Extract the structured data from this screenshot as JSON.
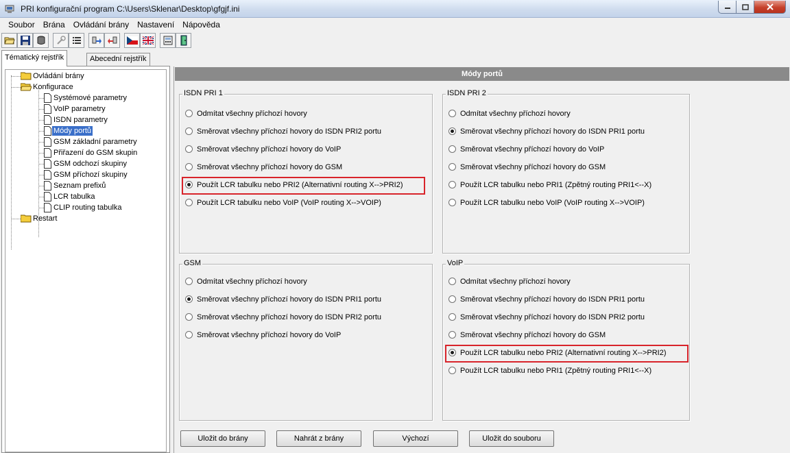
{
  "window": {
    "title": "PRI konfigurační program C:\\Users\\Sklenar\\Desktop\\gfgjf.ini"
  },
  "menu": [
    "Soubor",
    "Brána",
    "Ovládání brány",
    "Nastavení",
    "Nápověda"
  ],
  "tabs": {
    "topical": "Tématický rejstřík",
    "alphabetical": "Abecední rejstřík"
  },
  "tree": {
    "ovladani": "Ovládání brány",
    "konfigurace": "Konfigurace",
    "items": [
      "Systémové parametry",
      "VoIP parametry",
      "ISDN parametry",
      "Módy portů",
      "GSM základní parametry",
      "Přiřazení do GSM skupin",
      "GSM odchozí skupiny",
      "GSM příchozí skupiny",
      "Seznam prefixů",
      "LCR tabulka",
      "CLIP routing tabulka"
    ],
    "restart": "Restart",
    "selected": "Módy portů"
  },
  "panel": {
    "title": "Módy portů",
    "groups": {
      "pri1": {
        "title": "ISDN PRI 1",
        "options": [
          "Odmítat všechny příchozí hovory",
          "Směrovat všechny příchozí hovory do ISDN PRI2 portu",
          "Směrovat všechny příchozí hovory do VoIP",
          "Směrovat všechny příchozí hovory do GSM",
          "Použít LCR tabulku nebo PRI2 (Alternativní routing X-->PRI2)",
          "Použít LCR tabulku nebo VoIP (VoIP routing X-->VOIP)"
        ],
        "selected": 4
      },
      "pri2": {
        "title": "ISDN PRI 2",
        "options": [
          "Odmítat všechny příchozí hovory",
          "Směrovat všechny příchozí hovory do ISDN PRI1 portu",
          "Směrovat všechny příchozí hovory do VoIP",
          "Směrovat všechny příchozí hovory do GSM",
          "Použít LCR tabulku nebo PRI1 (Zpětný routing PRI1<--X)",
          "Použít LCR tabulku nebo VoIP (VoIP routing X-->VOIP)"
        ],
        "selected": 1
      },
      "gsm": {
        "title": "GSM",
        "options": [
          "Odmítat všechny příchozí hovory",
          "Směrovat všechny příchozí hovory do ISDN PRI1 portu",
          "Směrovat všechny příchozí hovory do ISDN PRI2 portu",
          "Směrovat všechny příchozí hovory do VoIP"
        ],
        "selected": 1
      },
      "voip": {
        "title": "VoIP",
        "options": [
          "Odmítat všechny příchozí hovory",
          "Směrovat všechny příchozí hovory do ISDN PRI1 portu",
          "Směrovat všechny příchozí hovory do ISDN PRI2 portu",
          "Směrovat všechny příchozí hovory do GSM",
          "Použít LCR tabulku nebo PRI2 (Alternativní routing X-->PRI2)",
          "Použít LCR tabulku nebo PRI1 (Zpětný routing PRI1<--X)"
        ],
        "selected": 4
      }
    }
  },
  "buttons": {
    "save_gateway": "Uložit do brány",
    "load_gateway": "Nahrát z brány",
    "default": "Výchozí",
    "save_file": "Uložit do souboru"
  }
}
